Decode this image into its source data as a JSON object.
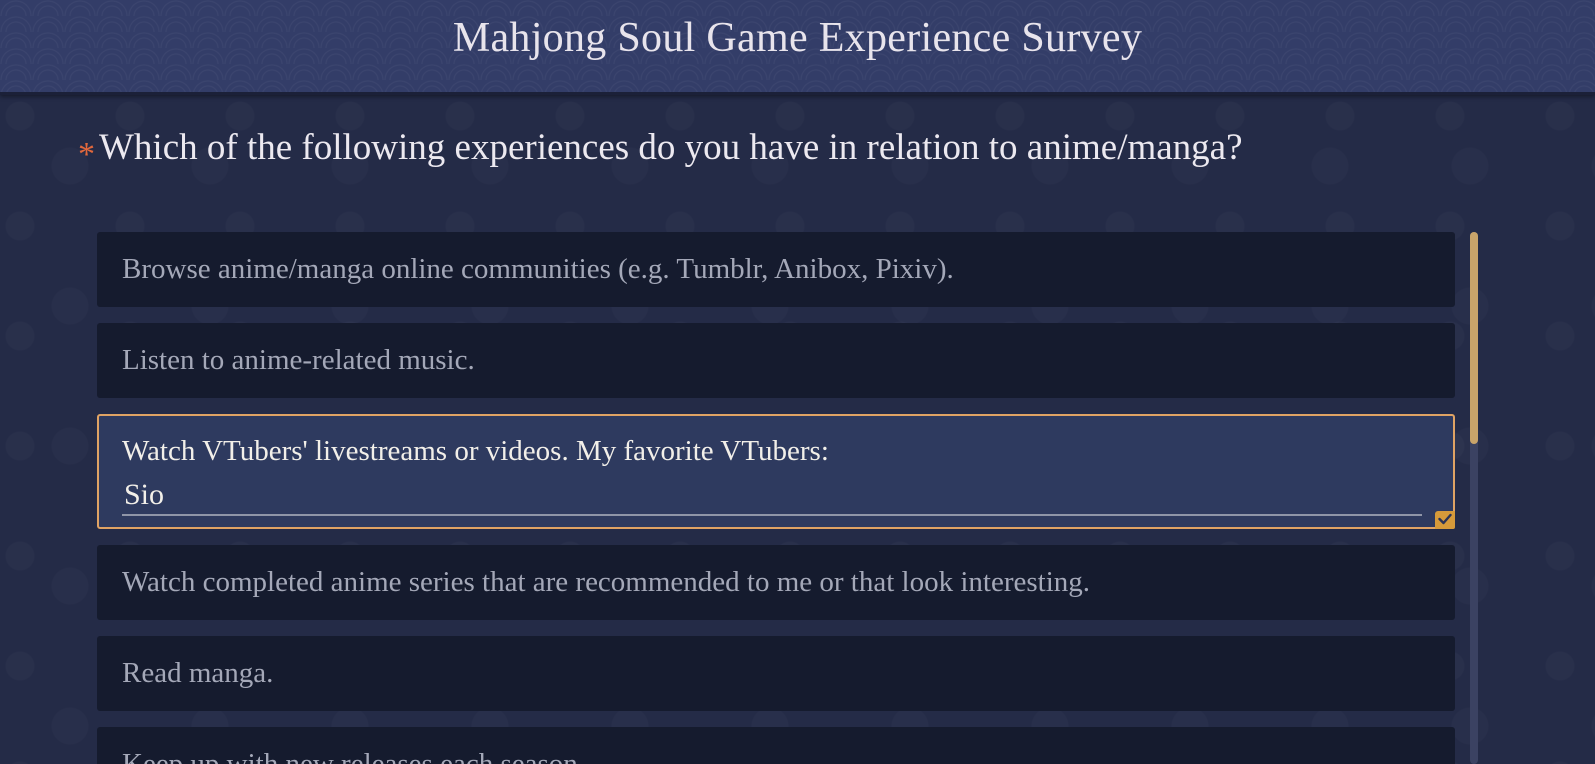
{
  "header": {
    "title": "Mahjong Soul Game Experience Survey"
  },
  "question": {
    "required_mark": "*",
    "text": "Which of the following experiences do you have in relation to anime/manga?"
  },
  "options": [
    {
      "label": "Browse anime/manga online communities (e.g. Tumblr, Anibox, Pixiv).",
      "selected": false
    },
    {
      "label": "Listen to anime-related music.",
      "selected": false
    },
    {
      "label": "Watch VTubers' livestreams or videos. My favorite VTubers:",
      "selected": true,
      "input_value": "Sio"
    },
    {
      "label": "Watch completed anime series that are recommended to me or that look interesting.",
      "selected": false
    },
    {
      "label": "Read manga.",
      "selected": false
    },
    {
      "label": "Keep up with new releases each season.",
      "selected": false
    }
  ],
  "icons": {
    "check": "check-icon"
  },
  "colors": {
    "accent": "#e0a364",
    "required": "#e2683c",
    "selected_bg": "#2e3a5f",
    "option_bg": "#151b2e",
    "scroll_thumb": "#c9a46a"
  },
  "scroll": {
    "position_fraction": 0
  }
}
